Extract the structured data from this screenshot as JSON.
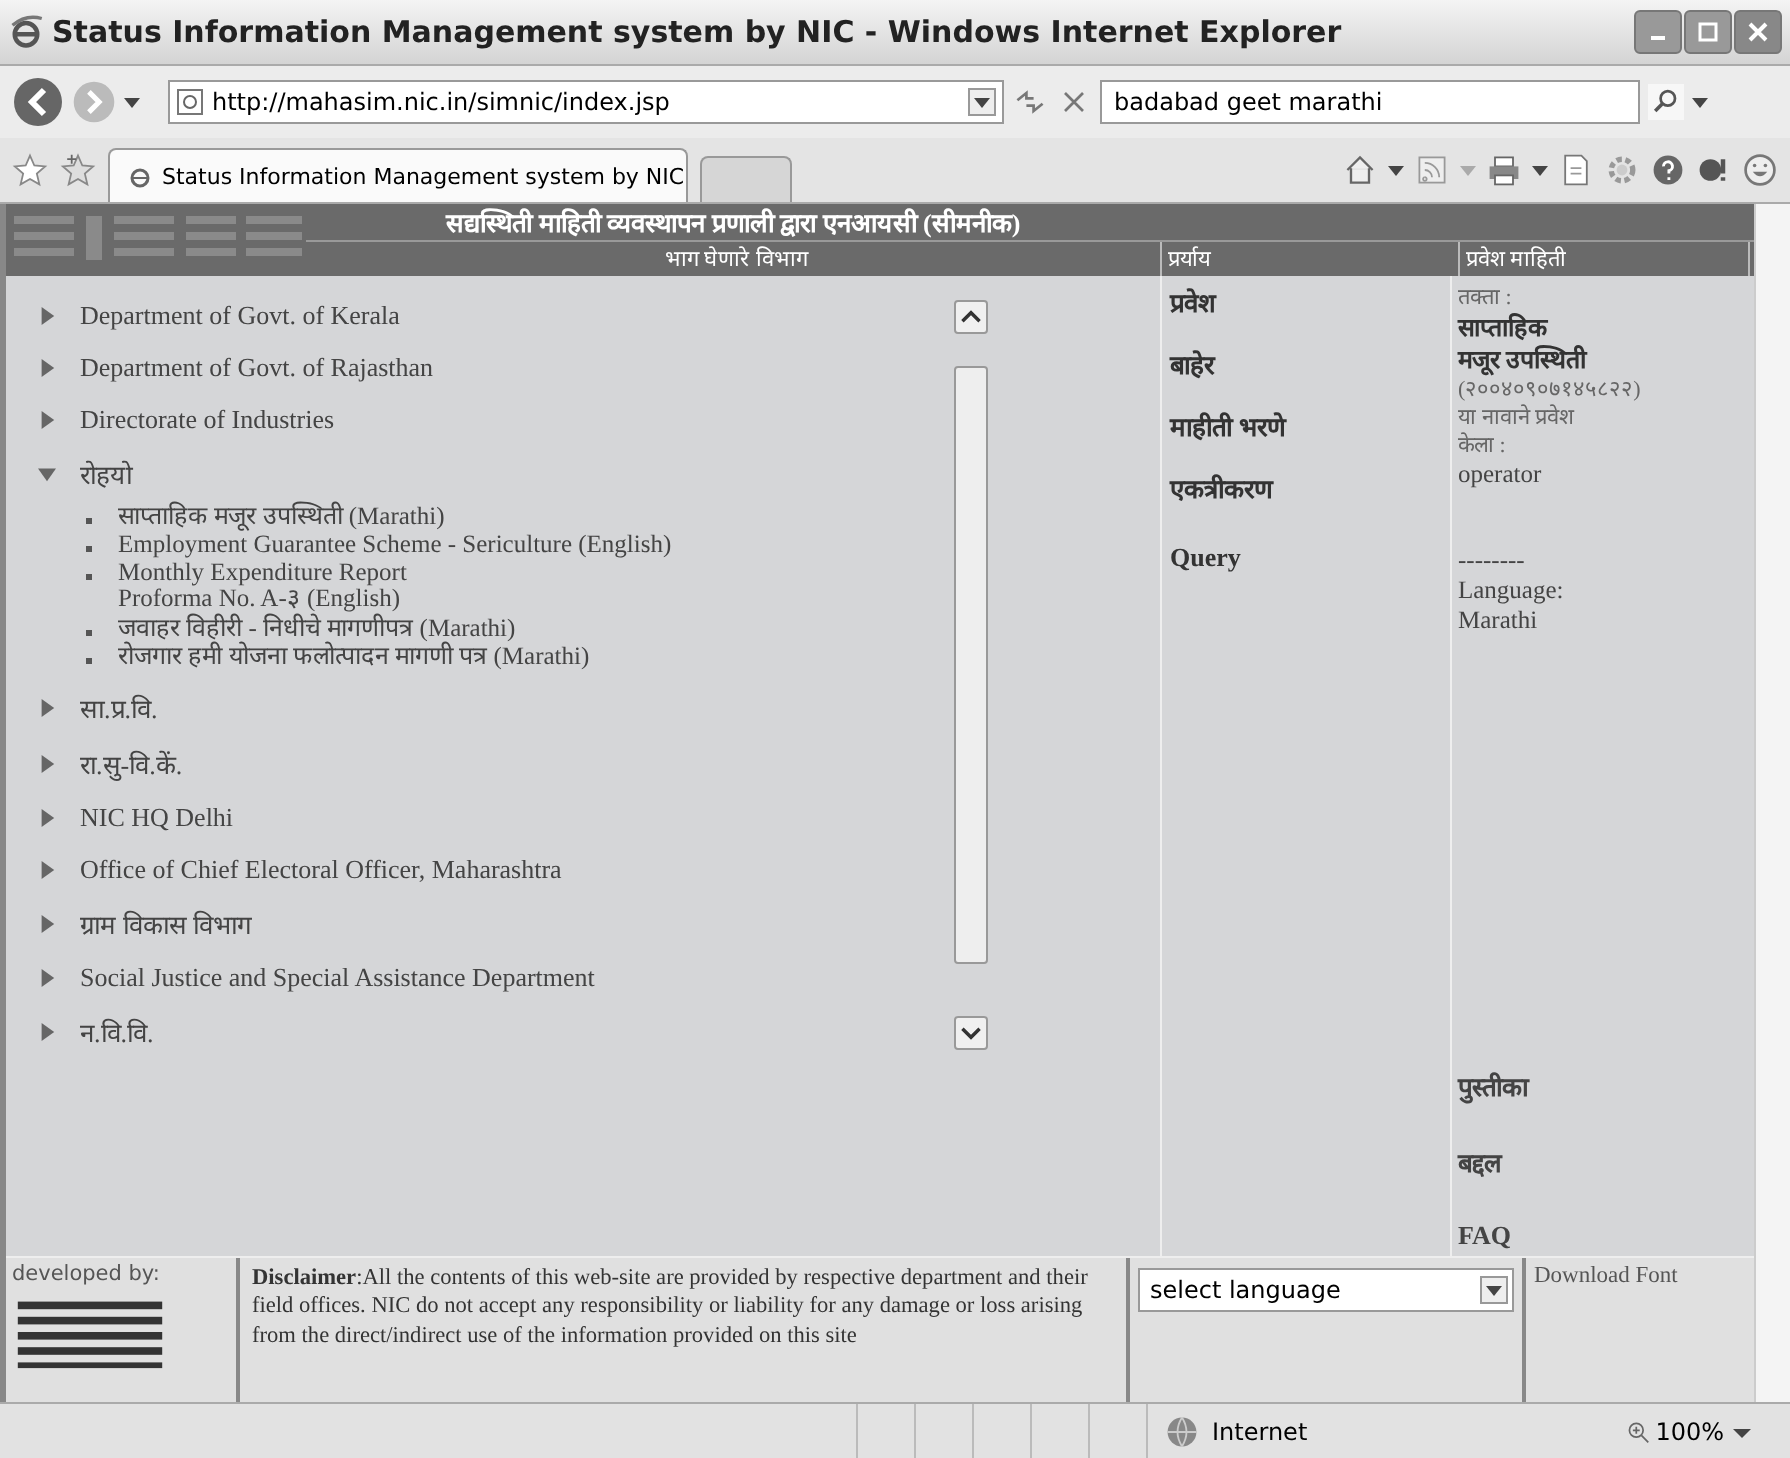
{
  "window": {
    "title": "Status Information Management system by NIC - Windows Internet Explorer"
  },
  "address_bar": {
    "value": "http://mahasim.nic.in/simnic/index.jsp"
  },
  "search": {
    "value": "badabad geet marathi"
  },
  "tabs": [
    {
      "label": "Status Information Management system by NIC",
      "selected": true
    },
    {
      "selected": false
    }
  ],
  "page": {
    "header": "सद्यस्थिती माहिती व्यवस्थापन प्रणाली द्वारा एनआयसी (सीमनीक)",
    "columns": [
      "भाग घेणारे विभाग",
      "प्रर्याय",
      "प्रवेश माहिती"
    ],
    "departments": [
      {
        "label": "Department of Govt. of Kerala",
        "expanded": false
      },
      {
        "label": "Department of Govt. of Rajasthan",
        "expanded": false
      },
      {
        "label": "Directorate of Industries",
        "expanded": false
      },
      {
        "label": "रोहयो",
        "expanded": true,
        "children": [
          "साप्ताहिक मजूर उपस्थिती (Marathi)",
          "Employment Guarantee Scheme - Sericulture (English)",
          "Monthly Expenditure Report\nProforma No. A-३ (English)",
          "जवाहर विहीरी - निधीचे मागणीपत्र (Marathi)",
          "रोजगार हमी योजना फलोत्पादन मागणी पत्र (Marathi)"
        ]
      },
      {
        "label": "सा.प्र.वि.",
        "expanded": false
      },
      {
        "label": "रा.सु-वि.कें.",
        "expanded": false
      },
      {
        "label": "NIC HQ Delhi",
        "expanded": false
      },
      {
        "label": "Office of Chief Electoral Officer, Maharashtra",
        "expanded": false
      },
      {
        "label": "ग्राम विकास विभाग",
        "expanded": false
      },
      {
        "label": "Social Justice and Special Assistance Department",
        "expanded": false
      },
      {
        "label": "न.वि.वि.",
        "expanded": false
      }
    ],
    "options": [
      "प्रवेश",
      "बाहेर",
      "माहीती भरणे",
      "एकत्रीकरण",
      "Query"
    ],
    "login_info": [
      {
        "kind": "small",
        "text": "तक्ता :"
      },
      {
        "kind": "bold",
        "text": "साप्ताहिक"
      },
      {
        "kind": "bold",
        "text": "मजूर उपस्थिती"
      },
      {
        "kind": "small",
        "text": "(२००४०९०७१४५८२२)"
      },
      {
        "kind": "small",
        "text": "या नावाने प्रवेश"
      },
      {
        "kind": "small",
        "text": "केला :"
      },
      {
        "kind": "value",
        "text": "operator"
      },
      {
        "kind": "gap"
      },
      {
        "kind": "value",
        "text": "--------"
      },
      {
        "kind": "value",
        "text": "Language:"
      },
      {
        "kind": "value",
        "text": "Marathi"
      }
    ],
    "bottom_links": [
      "पुस्तीका",
      "बद्दल",
      "FAQ"
    ],
    "footer": {
      "developed_by": "developed by:",
      "disclaimer": "**Disclaimer**:All the contents of this web-site are provided by respective department and their field offices. NIC do not accept any responsibility or liability for any damage or loss arising from the direct/indirect use of the information provided on this site",
      "language_select": "select language",
      "download_font": "Download Font"
    }
  },
  "status_bar": {
    "zone": "Internet",
    "zoom": "100%"
  }
}
